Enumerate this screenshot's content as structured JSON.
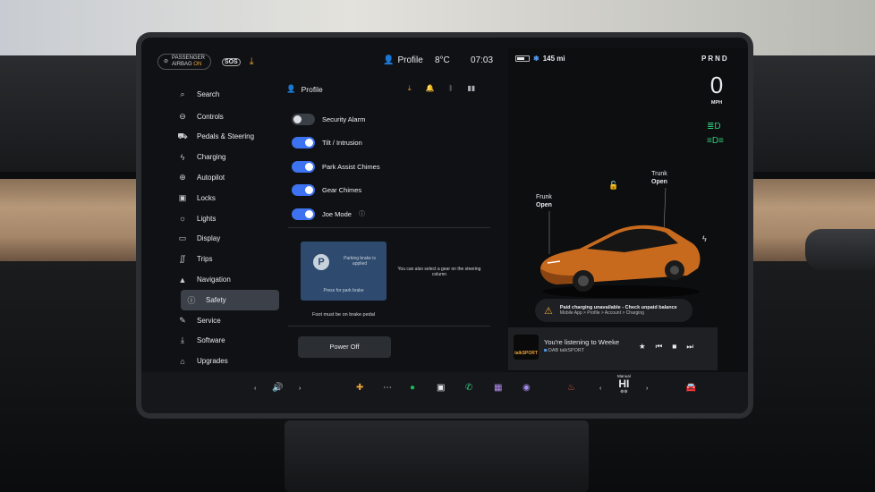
{
  "status_bar": {
    "airbag_line1": "PASSENGER",
    "airbag_line2": "AIRBAG",
    "airbag_state": "ON",
    "sos": "SOS",
    "profile": "Profile",
    "temperature": "8°C",
    "time": "07:03"
  },
  "nav": {
    "items": [
      {
        "label": "Search",
        "icon": "search-icon"
      },
      {
        "label": "Controls",
        "icon": "toggle-icon"
      },
      {
        "label": "Pedals & Steering",
        "icon": "car-icon"
      },
      {
        "label": "Charging",
        "icon": "bolt-icon"
      },
      {
        "label": "Autopilot",
        "icon": "steering-wheel-icon"
      },
      {
        "label": "Locks",
        "icon": "lock-icon"
      },
      {
        "label": "Lights",
        "icon": "sun-icon"
      },
      {
        "label": "Display",
        "icon": "display-icon"
      },
      {
        "label": "Trips",
        "icon": "trips-icon"
      },
      {
        "label": "Navigation",
        "icon": "navigation-arrow-icon"
      },
      {
        "label": "Safety",
        "icon": "info-icon"
      },
      {
        "label": "Service",
        "icon": "wrench-icon"
      },
      {
        "label": "Software",
        "icon": "download-icon"
      },
      {
        "label": "Upgrades",
        "icon": "bag-icon"
      }
    ],
    "active": "Safety"
  },
  "panel": {
    "title": "Profile",
    "toggles": [
      {
        "label": "Security Alarm",
        "on": false
      },
      {
        "label": "Tilt / Intrusion",
        "on": true
      },
      {
        "label": "Park Assist Chimes",
        "on": true
      },
      {
        "label": "Gear Chimes",
        "on": true
      },
      {
        "label": "Joe Mode",
        "on": true
      }
    ],
    "parking_brake_text": "Parking brake is applied",
    "parking_brake_footer": "Press for park brake",
    "parking_brake_side": "You can also select a gear on the steering column",
    "foot_note": "Foot must be on brake pedal",
    "power_off": "Power Off"
  },
  "vehicle": {
    "range": "145 mi",
    "gears": "PRND",
    "speed": "0",
    "speed_unit": "MPH",
    "frunk_label": "Frunk",
    "frunk_state": "Open",
    "trunk_label": "Trunk",
    "trunk_state": "Open",
    "alert_title": "Paid charging unavailable - Check unpaid balance",
    "alert_path": "Mobile App > Profile > Account > Charging",
    "car_color": "#c86a1e"
  },
  "media": {
    "station_logo": "talkSPORT",
    "title": "You're listening to Weeke",
    "source": "DAB talkSPORT"
  },
  "dock": {
    "climate_mode": "Manual",
    "climate_temp": "HI"
  }
}
